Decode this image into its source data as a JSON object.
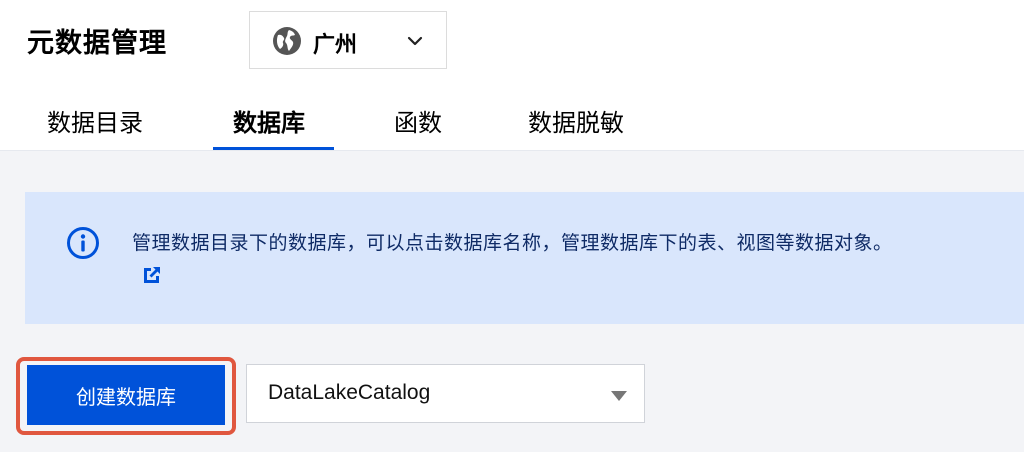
{
  "header": {
    "title": "元数据管理",
    "region": {
      "label": "广州",
      "icon": "globe-icon"
    }
  },
  "tabs": [
    {
      "label": "数据目录",
      "active": false
    },
    {
      "label": "数据库",
      "active": true
    },
    {
      "label": "函数",
      "active": false
    },
    {
      "label": "数据脱敏",
      "active": false
    }
  ],
  "info_banner": {
    "text": "管理数据目录下的数据库，可以点击数据库名称，管理数据库下的表、视图等数据对象。",
    "icon": "info-icon",
    "link_icon": "external-link-icon"
  },
  "toolbar": {
    "create_label": "创建数据库",
    "catalog_value": "DataLakeCatalog"
  },
  "colors": {
    "primary": "#0052d9",
    "banner_bg": "#d9e6fc",
    "highlight": "#e0573f",
    "page_bg": "#f3f4f7"
  }
}
